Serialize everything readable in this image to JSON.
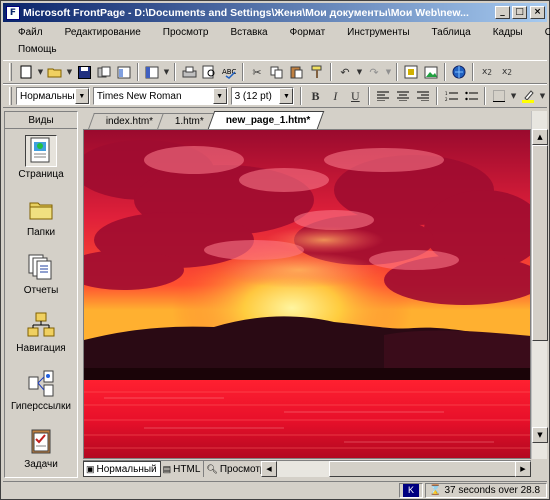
{
  "window": {
    "title": "Microsoft FrontPage - D:\\Documents and Settings\\Женя\\Мои документы\\Мои Web\\new..."
  },
  "menu": {
    "row1": [
      "Файл",
      "Редактирование",
      "Просмотр",
      "Вставка",
      "Формат",
      "Инструменты",
      "Таблица",
      "Кадры",
      "Окно"
    ],
    "row2": [
      "Помощь"
    ]
  },
  "format_toolbar": {
    "style": "Нормальный",
    "font": "Times New Roman",
    "size": "3  (12 pt)",
    "bold": "B",
    "italic": "I",
    "underline": "U"
  },
  "views_bar": {
    "header": "Виды",
    "items": [
      "Страница",
      "Папки",
      "Отчеты",
      "Навигация",
      "Гиперссылки",
      "Задачи"
    ]
  },
  "doc_tabs": [
    "index.htm*",
    "1.htm*",
    "new_page_1.htm*"
  ],
  "view_tabs": [
    "Нормальный",
    "HTML",
    "Просмотр"
  ],
  "status": {
    "kbd": "K",
    "time": "37 seconds over 28.8"
  },
  "colors": {
    "titlebar_start": "#0a246a",
    "titlebar_end": "#a6caf0",
    "sky_top": "#b00a2a",
    "sun": "#ffd83a",
    "water": "#e8102a"
  }
}
